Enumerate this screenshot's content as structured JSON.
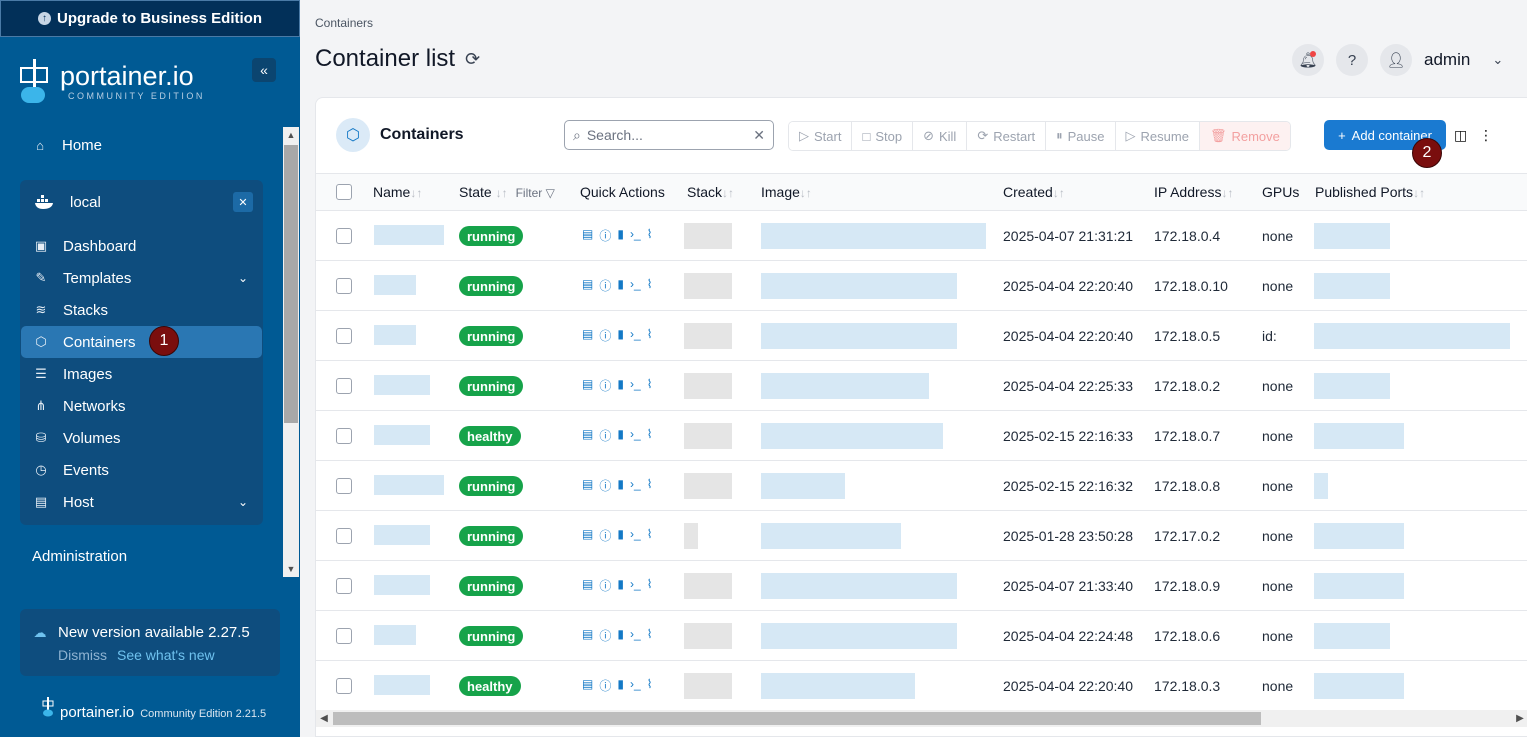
{
  "sidebar": {
    "upgrade_label": "Upgrade to Business Edition",
    "brand_name": "portainer.io",
    "brand_sub": "COMMUNITY EDITION",
    "home_label": "Home",
    "environment": {
      "name": "local"
    },
    "items": [
      {
        "label": "Dashboard",
        "icon": "dashboard-icon"
      },
      {
        "label": "Templates",
        "icon": "templates-icon"
      },
      {
        "label": "Stacks",
        "icon": "stacks-icon"
      },
      {
        "label": "Containers",
        "icon": "cube-icon"
      },
      {
        "label": "Images",
        "icon": "list-icon"
      },
      {
        "label": "Networks",
        "icon": "network-icon"
      },
      {
        "label": "Volumes",
        "icon": "database-icon"
      },
      {
        "label": "Events",
        "icon": "clock-icon"
      },
      {
        "label": "Host",
        "icon": "host-icon"
      }
    ],
    "active_badge": "1",
    "administration_label": "Administration",
    "new_version": {
      "text": "New version available 2.27.5",
      "dismiss": "Dismiss",
      "whats_new": "See what's new"
    },
    "footer": {
      "name": "portainer.io",
      "edition": "Community Edition 2.21.5"
    }
  },
  "header": {
    "breadcrumb": "Containers",
    "title": "Container list",
    "user": "admin"
  },
  "panel": {
    "title": "Containers",
    "search_placeholder": "Search...",
    "actions": [
      "Start",
      "Stop",
      "Kill",
      "Restart",
      "Pause",
      "Resume",
      "Remove"
    ],
    "add_label": "Add container",
    "add_badge": "2",
    "filter_label": "Filter",
    "columns": [
      "Name",
      "State",
      "Quick Actions",
      "Stack",
      "Image",
      "Created",
      "IP Address",
      "GPUs",
      "Published Ports"
    ]
  },
  "rows": [
    {
      "state": "running",
      "created": "2025-04-07 21:31:21",
      "ip": "172.18.0.4",
      "gpus": "none"
    },
    {
      "state": "running",
      "created": "2025-04-04 22:20:40",
      "ip": "172.18.0.10",
      "gpus": "none"
    },
    {
      "state": "running",
      "created": "2025-04-04 22:20:40",
      "ip": "172.18.0.5",
      "gpus": "id:"
    },
    {
      "state": "running",
      "created": "2025-04-04 22:25:33",
      "ip": "172.18.0.2",
      "gpus": "none"
    },
    {
      "state": "healthy",
      "created": "2025-02-15 22:16:33",
      "ip": "172.18.0.7",
      "gpus": "none"
    },
    {
      "state": "running",
      "created": "2025-02-15 22:16:32",
      "ip": "172.18.0.8",
      "gpus": "none"
    },
    {
      "state": "running",
      "created": "2025-01-28 23:50:28",
      "ip": "172.17.0.2",
      "gpus": "none"
    },
    {
      "state": "running",
      "created": "2025-04-07 21:33:40",
      "ip": "172.18.0.9",
      "gpus": "none"
    },
    {
      "state": "running",
      "created": "2025-04-04 22:24:48",
      "ip": "172.18.0.6",
      "gpus": "none"
    },
    {
      "state": "healthy",
      "created": "2025-04-04 22:20:40",
      "ip": "172.18.0.3",
      "gpus": "none"
    }
  ],
  "colors": {
    "sidebar": "#005a94",
    "accent": "#1a7ad1",
    "state_green": "#16a34a",
    "badge": "#7a0e0e"
  }
}
